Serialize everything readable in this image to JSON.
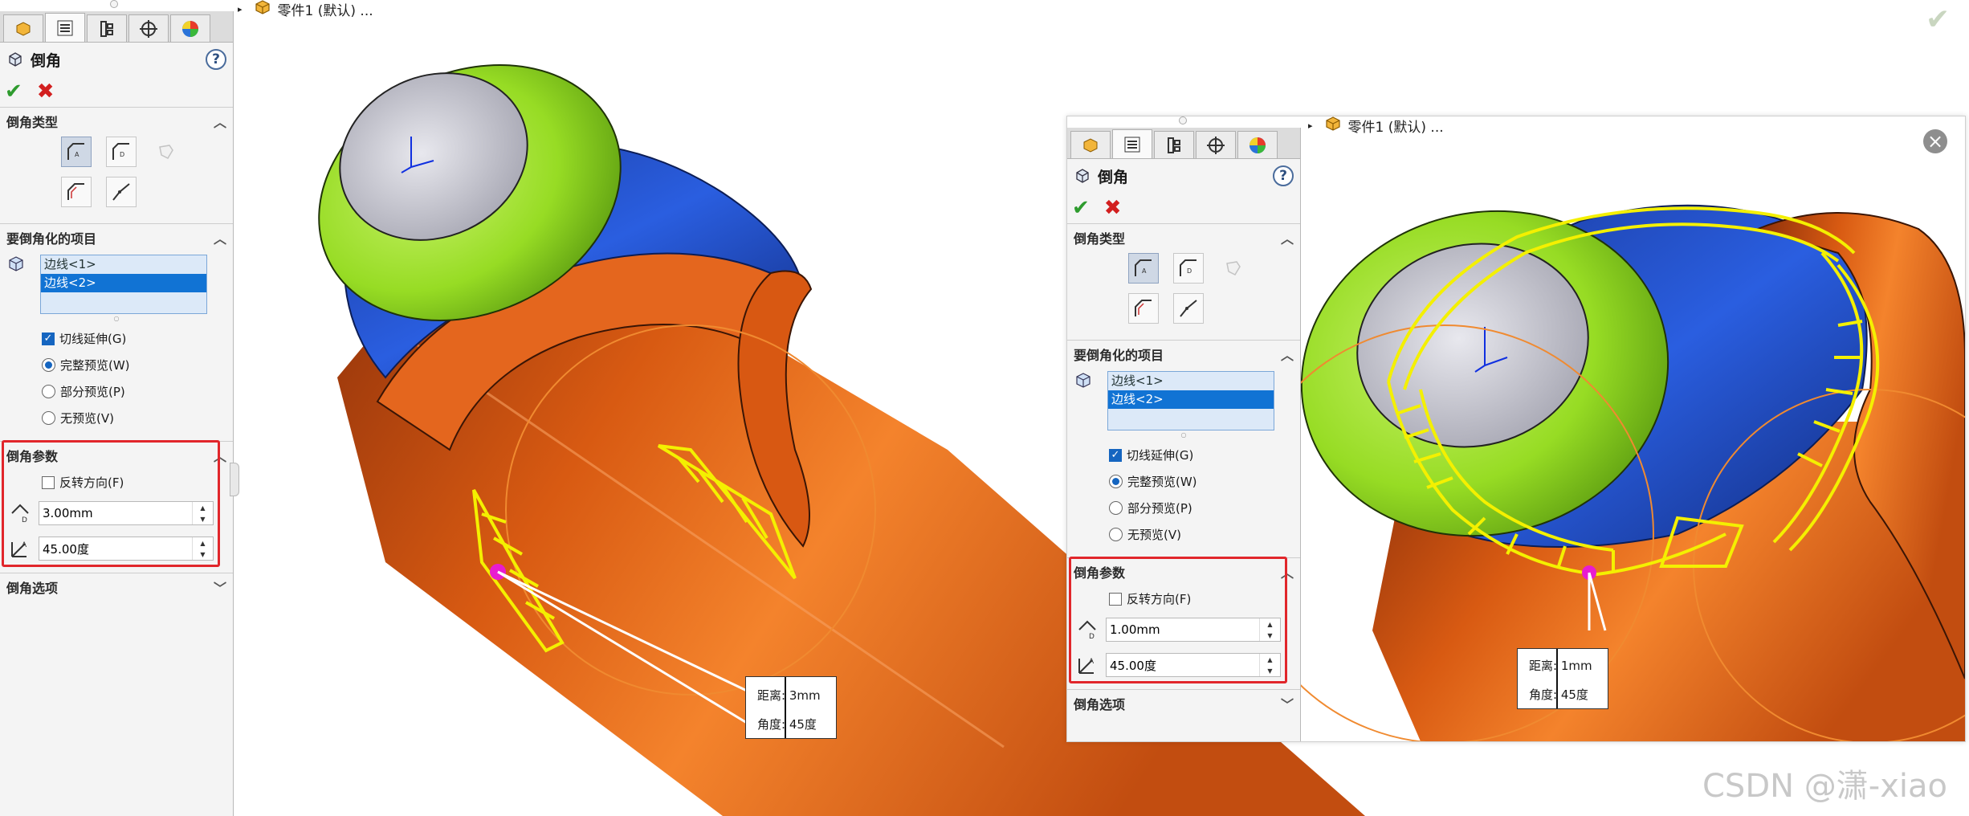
{
  "header": {
    "part_label": "零件1 (默认) ...",
    "breadcrumb_arrow": "▸"
  },
  "panel": {
    "title": "倒角",
    "help_label": "?",
    "ok_symbol": "✔",
    "cancel_symbol": "✖",
    "tabs": [
      "feature-manager-icon",
      "property-manager-icon",
      "configuration-manager-icon",
      "dimxpert-icon",
      "display-manager-icon"
    ],
    "chamfer_type": {
      "heading": "倒角类型",
      "buttons": [
        "angle-distance-icon",
        "distance-distance-icon",
        "vertex-icon",
        "offset-face-icon",
        "face-face-icon"
      ]
    },
    "items": {
      "heading": "要倒角化的项目",
      "edges": [
        "边线<1>",
        "边线<2>"
      ],
      "tangent_propagation": "切线延伸(G)",
      "preview_options": [
        "完整预览(W)",
        "部分预览(P)",
        "无预览(V)"
      ]
    },
    "params": {
      "heading": "倒角参数",
      "flip_direction": "反转方向(F)"
    },
    "options_heading": "倒角选项"
  },
  "left_view": {
    "distance_value": "3.00mm",
    "angle_value": "45.00度",
    "callout_distance": "距离: 3mm",
    "callout_angle": "角度: 45度"
  },
  "right_view": {
    "distance_value": "1.00mm",
    "angle_value": "45.00度",
    "callout_distance": "距离: 1mm",
    "callout_angle": "角度: 45度",
    "close_symbol": "×"
  },
  "watermark": "CSDN @潇-xiao",
  "colors": {
    "highlight_box": "#e1262b",
    "selected_edge": "#1173d4",
    "ok_green": "#2e9b2e",
    "cancel_red": "#d21f1f",
    "model_orange": "#e6661c",
    "model_blue": "#1f4fc4",
    "model_green": "#9be02a",
    "preview_yellow": "#f4f000"
  }
}
